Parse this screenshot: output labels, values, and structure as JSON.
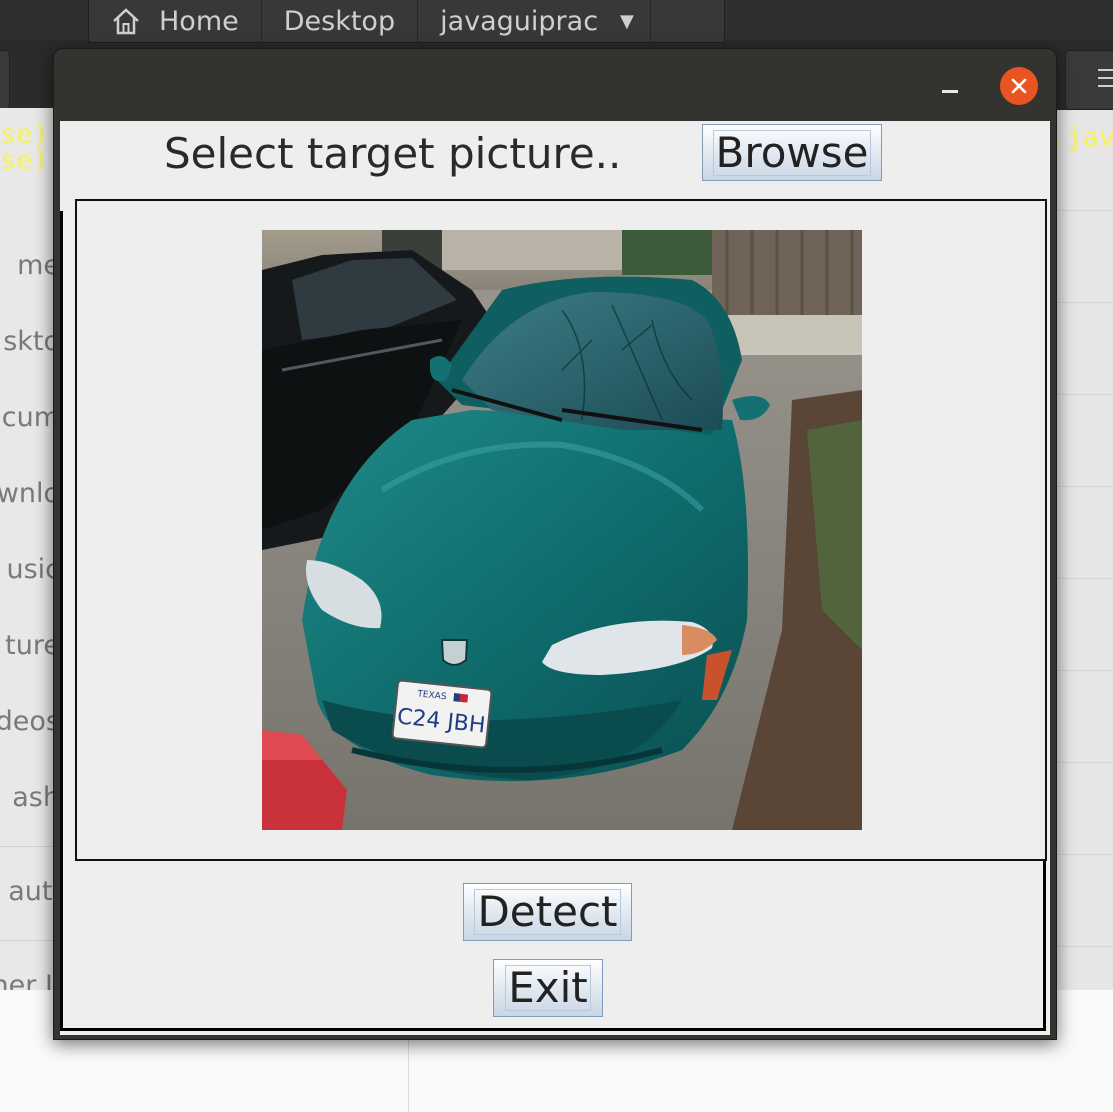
{
  "background": {
    "breadcrumb": [
      {
        "label": "Home",
        "icon": "home-icon"
      },
      {
        "label": "Desktop"
      },
      {
        "label": "javaguiprac",
        "has_dropdown": true
      }
    ],
    "sidebar_items": [
      "me",
      "skto",
      "cum",
      "wnlo",
      "usic",
      "ture",
      "deos",
      "ash",
      "auti",
      "her L"
    ],
    "code_left": [
      "se)",
      "se)"
    ],
    "code_right": ".jav"
  },
  "window": {
    "prompt_text": "Select target picture..",
    "browse_label": "Browse",
    "detect_label": "Detect",
    "exit_label": "Exit",
    "plate_text": "C24 JBH",
    "plate_state": "TEXAS"
  },
  "colors": {
    "close_button": "#e95420",
    "code_text": "#f7f25a",
    "car_body": "#0f6b6b",
    "button_border": "#7f9db9"
  }
}
